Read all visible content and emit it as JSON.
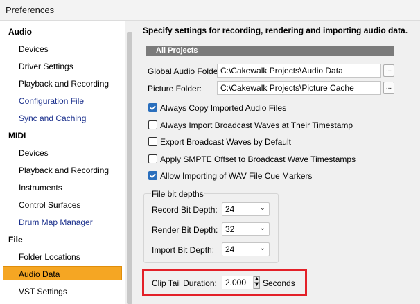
{
  "window": {
    "title": "Preferences"
  },
  "sidebar": {
    "categories": [
      {
        "label": "Audio",
        "items": [
          "Devices",
          "Driver Settings",
          "Playback and Recording",
          "Configuration File",
          "Sync and Caching"
        ]
      },
      {
        "label": "MIDI",
        "items": [
          "Devices",
          "Playback and Recording",
          "Instruments",
          "Control Surfaces",
          "Drum Map Manager"
        ]
      },
      {
        "label": "File",
        "items": [
          "Folder Locations",
          "Audio Data",
          "VST Settings"
        ]
      }
    ],
    "selected": "Audio Data"
  },
  "main": {
    "description": "Specify settings for recording, rendering and importing audio data.",
    "section_title": "All Projects",
    "global_audio_folder_label": "Global Audio Folder:",
    "global_audio_folder_value": "C:\\Cakewalk Projects\\Audio Data",
    "picture_folder_label": "Picture Folder:",
    "picture_folder_value": "C:\\Cakewalk Projects\\Picture Cache",
    "browse_label": "...",
    "checkboxes": [
      {
        "label": "Always Copy Imported Audio Files",
        "checked": true
      },
      {
        "label": "Always Import Broadcast Waves at Their Timestamp",
        "checked": false
      },
      {
        "label": "Export Broadcast Waves by Default",
        "checked": false
      },
      {
        "label": "Apply SMPTE Offset to Broadcast Wave Timestamps",
        "checked": false
      },
      {
        "label": "Allow Importing of WAV File Cue Markers",
        "checked": true
      }
    ],
    "bit_depths": {
      "title": "File bit depths",
      "record_label": "Record Bit Depth:",
      "record_value": "24",
      "render_label": "Render Bit Depth:",
      "render_value": "32",
      "import_label": "Import Bit Depth:",
      "import_value": "24"
    },
    "clip_tail": {
      "label": "Clip Tail Duration:",
      "value": "2.000",
      "unit": "Seconds"
    }
  },
  "colors": {
    "selection": "#f5a623",
    "highlight": "#e32028",
    "checkbox": "#2a6fbd"
  }
}
